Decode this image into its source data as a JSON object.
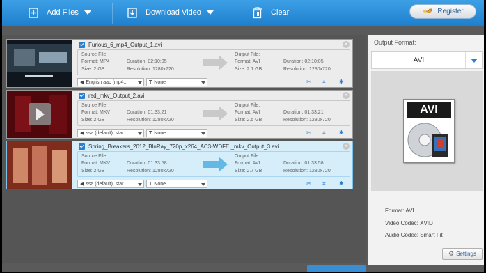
{
  "toolbar": {
    "add_files_label": "Add Files",
    "download_video_label": "Download Video",
    "clear_label": "Clear",
    "register_label": "Register"
  },
  "items": [
    {
      "file_name": "Furious_6_mp4_Output_1.avi",
      "source_label": "Source File:",
      "source_format": "Format: MP4",
      "source_duration": "Duration: 02:10:05",
      "source_size": "Size: 2 GB",
      "source_resolution": "Resolution: 1280x720",
      "output_label": "Output File:",
      "output_format": "Format: AVI",
      "output_duration": "Duration: 02:10:05",
      "output_size": "Size: 2.1 GB",
      "output_resolution": "Resolution: 1280x720",
      "audio_track": "English aac (mp4...",
      "subtitle": "None"
    },
    {
      "file_name": "red_mkv_Output_2.avi",
      "source_label": "Source File:",
      "source_format": "Format: MKV",
      "source_duration": "Duration: 01:33:21",
      "source_size": "Size: 2 GB",
      "source_resolution": "Resolution: 1280x720",
      "output_label": "Output File:",
      "output_format": "Format: AVI",
      "output_duration": "Duration: 01:33:21",
      "output_size": "Size: 2.5 GB",
      "output_resolution": "Resolution: 1280x720",
      "audio_track": "ssa (default), star...",
      "subtitle": "None"
    },
    {
      "file_name": "Spring_Breakers_2012_BluRay_720p_x264_AC3-WDFEI_mkv_Output_3.avi",
      "source_label": "Source File:",
      "source_format": "Format: MKV",
      "source_duration": "Duration: 01:33:58",
      "source_size": "Size: 2 GB",
      "source_resolution": "Resolution: 1280x720",
      "output_label": "Output File:",
      "output_format": "Format: AVI",
      "output_duration": "Duration: 01:33:58",
      "output_size": "Size: 2.7 GB",
      "output_resolution": "Resolution: 1280x720",
      "audio_track": "ssa (default), star...",
      "subtitle": "None"
    }
  ],
  "panel": {
    "title": "Output Format:",
    "format_value": "AVI",
    "icon_text": "AVI",
    "format_line": "Format: AVI",
    "video_codec_line": "Video Codec: XVID",
    "audio_codec_line": "Audio Codec: Smart Fit",
    "settings_label": "Settings"
  },
  "icons": {
    "add_files": "add-files-icon",
    "download": "download-icon",
    "clear": "trash-icon",
    "register": "key-icon",
    "cut": "scissors-icon",
    "crop": "crop-icon",
    "effects": "effects-icon",
    "speaker": "speaker-icon",
    "subtitle": "subtitle-icon",
    "play": "play-icon",
    "settings": "gear-icon"
  },
  "colors": {
    "accent": "#2b7fd1",
    "toolbar": "#1e7fcd",
    "selected_row": "#d6eef9"
  }
}
